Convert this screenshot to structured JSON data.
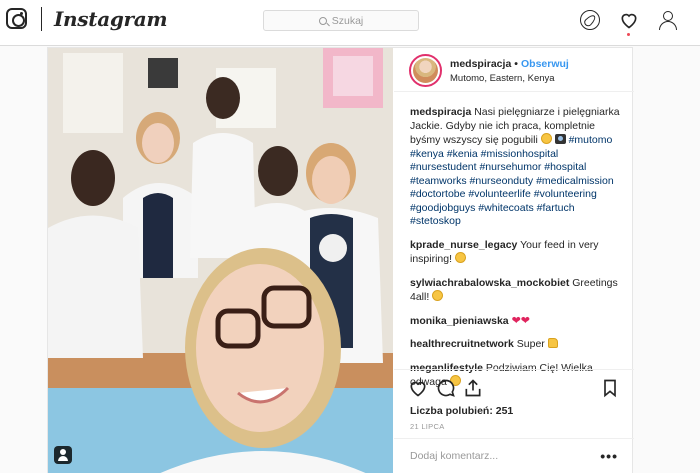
{
  "app": {
    "name": "Instagram"
  },
  "search": {
    "placeholder": "Szukaj"
  },
  "post": {
    "username": "medspiracja",
    "follow_label": "Obserwuj",
    "location": "Mutomo, Eastern, Kenya",
    "caption_user": "medspiracja",
    "caption_text": "Nasi pielęgniarze i pielęgniarka Jackie. Gdyby nie ich praca, kompletnie byśmy wszyscy się pogubili",
    "hashtags": "#mutomo #kenya #kenia #missionhospital #nursestudent #nursehumor #hospital #teamworks #nurseonduty #medicalmission #doctortobe #volunteerlife #volunteering #goodjobguys #whitecoats #fartuch #stetoskop",
    "comments": [
      {
        "user": "kprade_nurse_legacy",
        "text": "Your feed in very inspiring!"
      },
      {
        "user": "sylwiachrabalowska_mockobiet",
        "text": "Greetings 4all!"
      },
      {
        "user": "monika_pieniawska",
        "text": ""
      },
      {
        "user": "healthrecruitnetwork",
        "text": "Super"
      },
      {
        "user": "meganlifestyle",
        "text": "Podziwiam Cię! Wielka odwaga"
      }
    ],
    "likes_label": "Liczba polubień: 251",
    "date": "21 LIPCA",
    "comment_placeholder": "Dodaj komentarz...",
    "more_label": "•••"
  },
  "colors": {
    "accent": "#3897f0",
    "hashtag": "#003569",
    "notification": "#ed4956"
  },
  "icons": [
    "instagram-camera-icon",
    "search-icon",
    "compass-icon",
    "heart-icon",
    "profile-icon",
    "like-icon",
    "comment-icon",
    "share-icon",
    "bookmark-icon",
    "user-tag-icon"
  ]
}
